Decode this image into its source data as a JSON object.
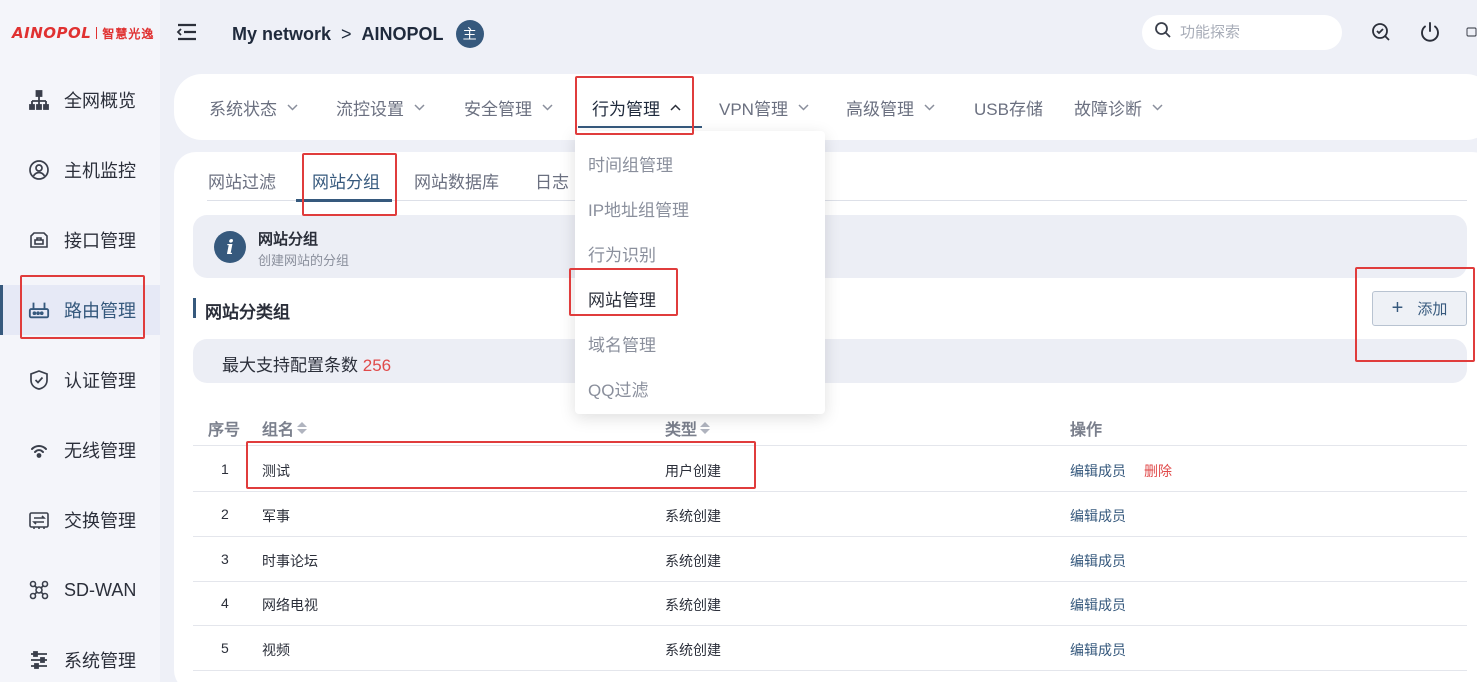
{
  "logo": {
    "brand": "AINOPOL",
    "cn": "智慧光逸"
  },
  "sidebar": {
    "items": [
      {
        "label": "全网概览",
        "icon": "network-topology-icon"
      },
      {
        "label": "主机监控",
        "icon": "user-circle-icon"
      },
      {
        "label": "接口管理",
        "icon": "port-icon"
      },
      {
        "label": "路由管理",
        "icon": "router-icon",
        "active": true
      },
      {
        "label": "认证管理",
        "icon": "shield-check-icon"
      },
      {
        "label": "无线管理",
        "icon": "wifi-icon"
      },
      {
        "label": "交换管理",
        "icon": "switch-icon"
      },
      {
        "label": "SD-WAN",
        "icon": "sdwan-icon"
      },
      {
        "label": "系统管理",
        "icon": "sliders-icon"
      }
    ]
  },
  "header": {
    "breadcrumb": [
      "My network",
      "AINOPOL"
    ],
    "avatar": "主",
    "search_placeholder": "功能探索"
  },
  "topmenu": {
    "items": [
      "系统状态",
      "流控设置",
      "安全管理",
      "行为管理",
      "VPN管理",
      "高级管理",
      "USB存储",
      "故障诊断"
    ],
    "active": "行为管理"
  },
  "dropdown": {
    "items": [
      "时间组管理",
      "IP地址组管理",
      "行为识别",
      "网站管理",
      "域名管理",
      "QQ过滤"
    ],
    "active": "网站管理"
  },
  "subtabs": {
    "items": [
      "网站过滤",
      "网站分组",
      "网站数据库",
      "日志"
    ],
    "active": "网站分组"
  },
  "info": {
    "title": "网站分组",
    "subtitle": "创建网站的分组"
  },
  "section": {
    "title": "网站分类组",
    "add_label": "添加"
  },
  "max_config": {
    "label": "最大支持配置条数",
    "value": "256"
  },
  "table": {
    "headers": {
      "index": "序号",
      "name": "组名",
      "type": "类型",
      "actions": "操作"
    },
    "rows": [
      {
        "index": "1",
        "name": "测试",
        "type": "用户创建",
        "edit": "编辑成员",
        "delete": "删除"
      },
      {
        "index": "2",
        "name": "军事",
        "type": "系统创建",
        "edit": "编辑成员"
      },
      {
        "index": "3",
        "name": "时事论坛",
        "type": "系统创建",
        "edit": "编辑成员"
      },
      {
        "index": "4",
        "name": "网络电视",
        "type": "系统创建",
        "edit": "编辑成员"
      },
      {
        "index": "5",
        "name": "视频",
        "type": "系统创建",
        "edit": "编辑成员"
      }
    ]
  },
  "colors": {
    "accent": "#36597d",
    "danger": "#e04a4a",
    "annotation": "#e03c3c"
  }
}
